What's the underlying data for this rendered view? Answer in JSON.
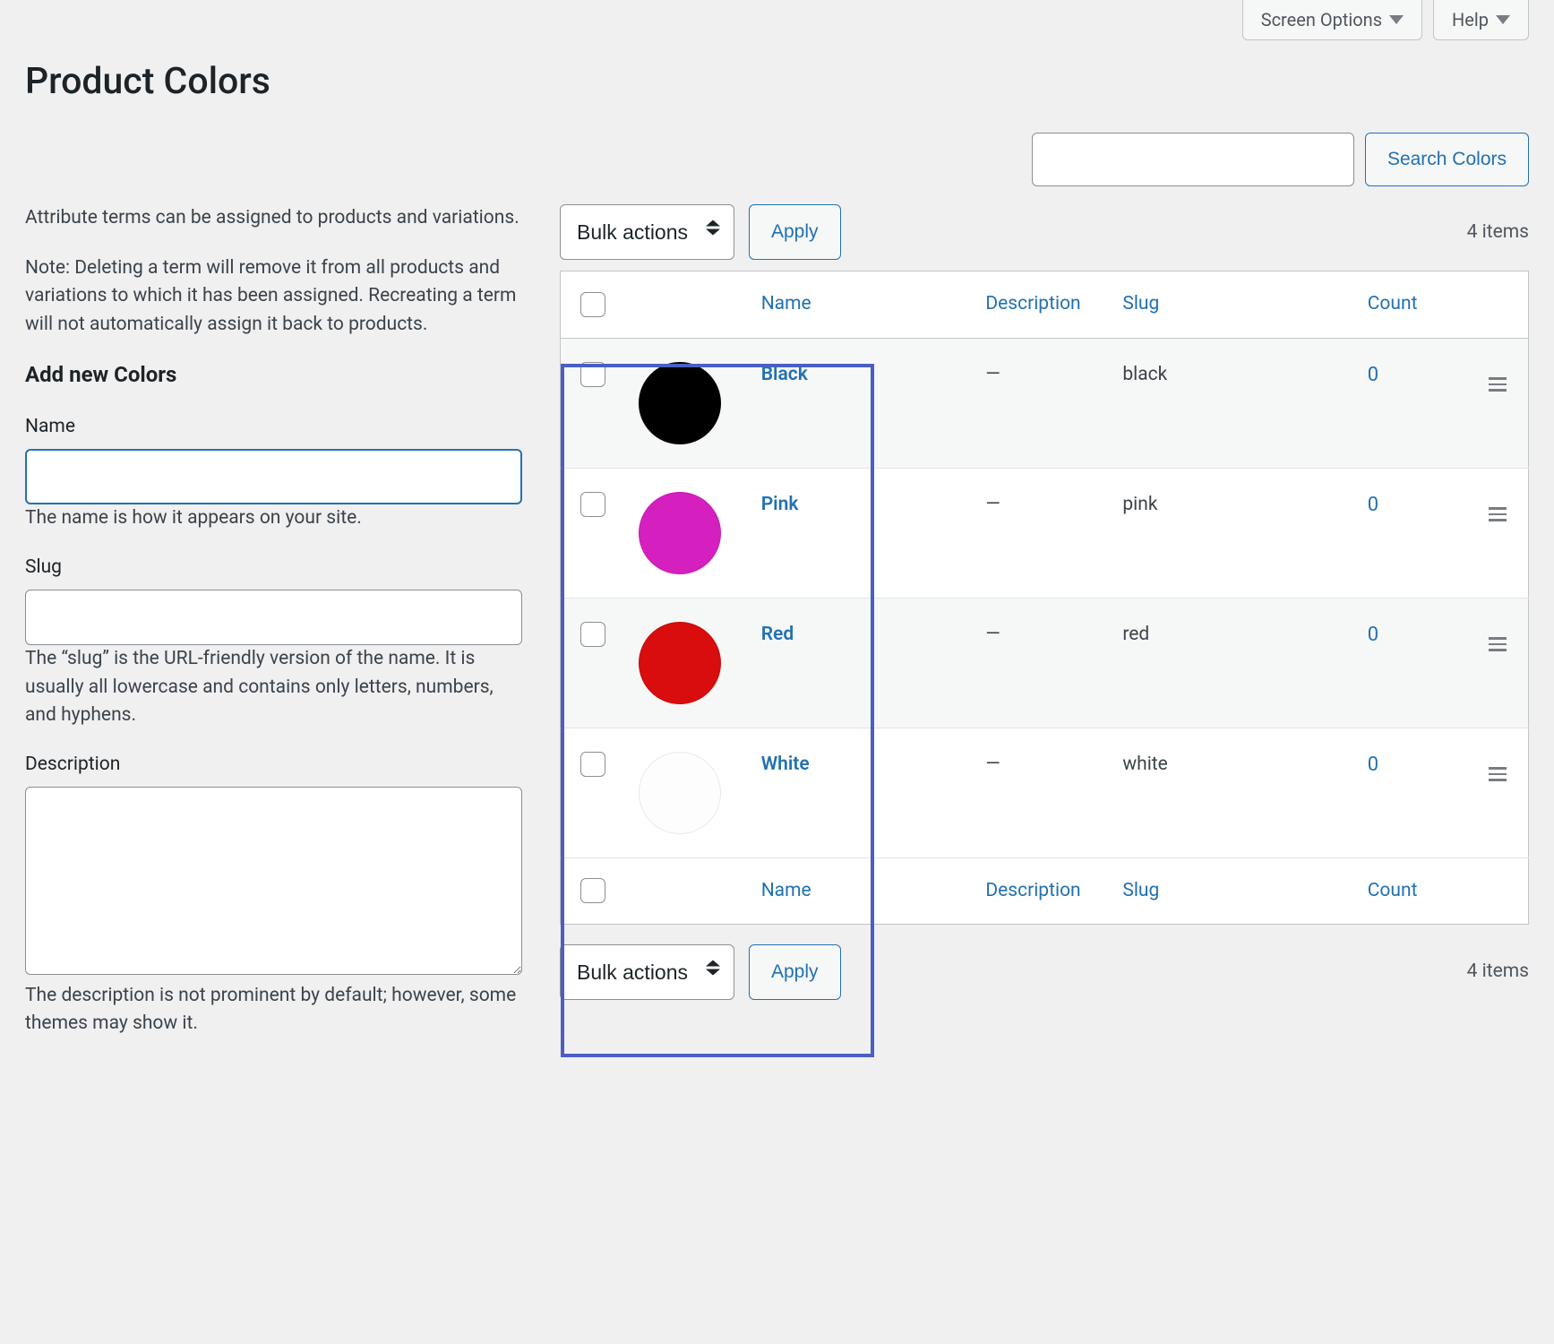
{
  "topTabs": {
    "screenOptions": "Screen Options",
    "help": "Help"
  },
  "pageTitle": "Product Colors",
  "search": {
    "buttonLabel": "Search Colors",
    "value": ""
  },
  "intro": {
    "p1": "Attribute terms can be assigned to products and variations.",
    "p2": "Note: Deleting a term will remove it from all products and variations to which it has been assigned. Recreating a term will not automatically assign it back to products."
  },
  "form": {
    "heading": "Add new Colors",
    "name": {
      "label": "Name",
      "help": "The name is how it appears on your site.",
      "value": ""
    },
    "slug": {
      "label": "Slug",
      "help": "The “slug” is the URL-friendly version of the name. It is usually all lowercase and contains only letters, numbers, and hyphens.",
      "value": ""
    },
    "description": {
      "label": "Description",
      "help": "The description is not prominent by default; however, some themes may show it.",
      "value": ""
    }
  },
  "bulk": {
    "selectLabel": "Bulk actions",
    "applyLabel": "Apply"
  },
  "itemsCount": "4 items",
  "columns": {
    "name": "Name",
    "description": "Description",
    "slug": "Slug",
    "count": "Count"
  },
  "emptyDesc": "—",
  "rows": [
    {
      "name": "Black",
      "swatch": "#000000",
      "description": "",
      "slug": "black",
      "count": "0"
    },
    {
      "name": "Pink",
      "swatch": "#d61fbf",
      "description": "",
      "slug": "pink",
      "count": "0"
    },
    {
      "name": "Red",
      "swatch": "#d90d0d",
      "description": "",
      "slug": "red",
      "count": "0"
    },
    {
      "name": "White",
      "swatch": "#fdfdfd",
      "description": "",
      "slug": "white",
      "count": "0"
    }
  ]
}
